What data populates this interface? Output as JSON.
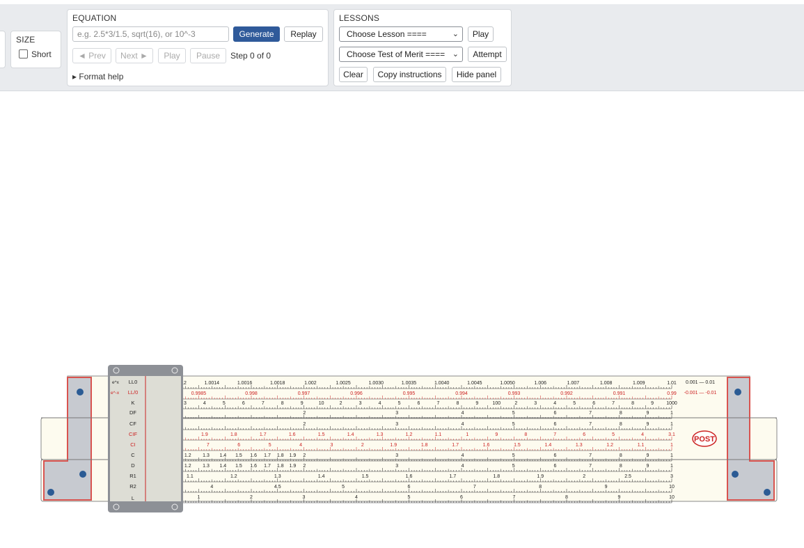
{
  "size_panel": {
    "title": "SIZE",
    "short_label": "Short",
    "short_checked": false
  },
  "equation_panel": {
    "title": "EQUATION",
    "input_value": "",
    "input_placeholder": "e.g. 2.5*3/1.5, sqrt(16), or 10^-3",
    "generate_label": "Generate",
    "replay_label": "Replay",
    "prev_label": "◄ Prev",
    "next_label": "Next ►",
    "play_label": "Play",
    "pause_label": "Pause",
    "step_text": "Step 0 of 0",
    "format_help_label": "▸ Format help"
  },
  "lessons_panel": {
    "title": "LESSONS",
    "lesson_select": "Choose Lesson ====",
    "play_label": "Play",
    "test_select": "Choose Test of Merit ====",
    "attempt_label": "Attempt",
    "clear_label": "Clear",
    "copy_label": "Copy instructions",
    "hide_label": "Hide panel"
  },
  "slide_rule": {
    "brand": "POST",
    "upper_scales": [
      "e^x",
      "LL0",
      "e^-x",
      "LL/0",
      "K",
      "DF"
    ],
    "slide_scales": [
      "CF",
      "CIF",
      "CI",
      "C"
    ],
    "lower_scales": [
      "D",
      "R1",
      "R2",
      "L"
    ],
    "ll0_range_label": "0.001 — 0.01",
    "ll00_range_label": "-0.001 — -0.01",
    "ll0_ticks": [
      "1.001",
      "1.0012",
      "1.0014",
      "1.0016",
      "1.0018",
      "1.002",
      "1.0025",
      "1.0030",
      "1.0035",
      "1.0040",
      "1.0045",
      "1.0050",
      "1.006",
      "1.007",
      "1.008",
      "1.009",
      "1.01"
    ],
    "ll00_ticks": [
      "0.999",
      "0.9985",
      "0.998",
      "0.997",
      "0.996",
      "0.995",
      "0.994",
      "0.993",
      "0.992",
      "0.991",
      "0.99"
    ],
    "c_ticks": [
      "1",
      "1.1",
      "1.2",
      "1.3",
      "1.4",
      "1.5",
      "1.6",
      "1.7",
      "1.8",
      "1.9",
      "2",
      "3",
      "4",
      "5",
      "6",
      "7",
      "8",
      "9",
      "1"
    ],
    "d_ticks": [
      "1",
      "1.1",
      "1.2",
      "1.3",
      "1.4",
      "1.5",
      "1.6",
      "1.7",
      "1.8",
      "1.9",
      "2",
      "3",
      "4",
      "5",
      "6",
      "7",
      "8",
      "9",
      "1"
    ],
    "k_ticks": [
      "1",
      "2",
      "3",
      "4",
      "5",
      "6",
      "7",
      "8",
      "9",
      "10",
      "2",
      "3",
      "4",
      "5",
      "6",
      "7",
      "8",
      "9",
      "100",
      "2",
      "3",
      "4",
      "5",
      "6",
      "7",
      "8",
      "9",
      "1000"
    ],
    "ci_ticks": [
      "9",
      "8",
      "7",
      "6",
      "5",
      "4",
      "3",
      "2",
      "1.9",
      "1.8",
      "1.7",
      "1.6",
      "1.5",
      "1.4",
      "1.3",
      "1.2",
      "1.1",
      "1"
    ],
    "cif_ticks": [
      "3",
      "2",
      "1.9",
      "1.8",
      "1.7",
      "1.6",
      "1.5",
      "1.4",
      "1.3",
      "1.2",
      "1.1",
      "1",
      "9",
      "8",
      "7",
      "6",
      "5",
      "4",
      "3.1"
    ],
    "r1_ticks": [
      "1",
      "1.1",
      "1.2",
      "1.3",
      "1.4",
      "1.5",
      "1.6",
      "1.7",
      "1.8",
      "1.9",
      "2",
      "2.5",
      "3"
    ],
    "r2_ticks": [
      "3.5",
      "4",
      "4.5",
      "5",
      "6",
      "7",
      "8",
      "9",
      "10"
    ],
    "l_ticks": [
      "0",
      "1",
      "2",
      "3",
      "4",
      "5",
      "6",
      "7",
      "8",
      "9",
      "10"
    ],
    "colors": {
      "stock": "#fdfbef",
      "frame_red": "#d9534f",
      "bracket": "#c7cad0",
      "dot": "#2b5b94",
      "cursor_glass": "#e4e4da",
      "cursor_frame": "#8d9096",
      "red_scale": "#cc2222"
    }
  }
}
